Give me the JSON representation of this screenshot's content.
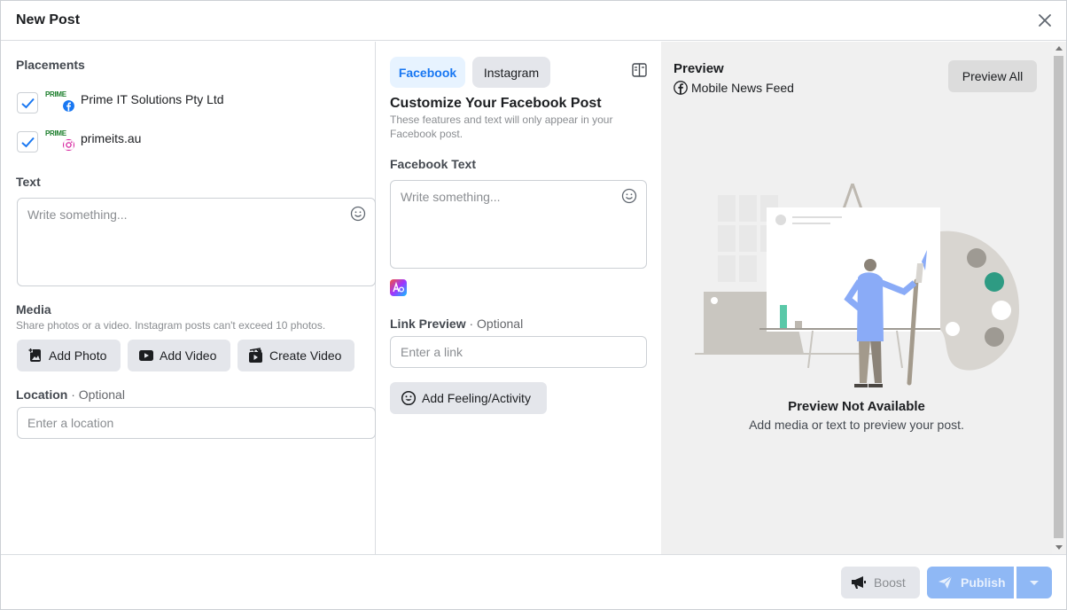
{
  "dialog": {
    "title": "New Post"
  },
  "placements": {
    "title": "Placements",
    "items": [
      {
        "name": "Prime IT Solutions Pty Ltd",
        "network": "facebook",
        "checked": true,
        "logo_text": "PRIME"
      },
      {
        "name": "primeits.au",
        "network": "instagram",
        "checked": true,
        "logo_text": "PRIME"
      }
    ]
  },
  "text_section": {
    "title": "Text",
    "placeholder": "Write something..."
  },
  "media": {
    "title": "Media",
    "hint": "Share photos or a video. Instagram posts can't exceed 10 photos.",
    "buttons": [
      "Add Photo",
      "Add Video",
      "Create Video"
    ]
  },
  "location": {
    "title": "Location",
    "optional": "· Optional",
    "placeholder": "Enter a location"
  },
  "tabs": {
    "facebook": "Facebook",
    "instagram": "Instagram"
  },
  "customize": {
    "title": "Customize Your Facebook Post",
    "hint": "These features and text will only appear in your Facebook post.",
    "fb_text_title": "Facebook Text",
    "fb_text_placeholder": "Write something...",
    "link_title": "Link Preview",
    "link_optional": "· Optional",
    "link_placeholder": "Enter a link",
    "feeling_label": "Add Feeling/Activity"
  },
  "preview": {
    "title": "Preview",
    "feed": "Mobile News Feed",
    "preview_all": "Preview All",
    "unavailable_title": "Preview Not Available",
    "unavailable_text": "Add media or text to preview your post."
  },
  "footer": {
    "boost": "Boost",
    "publish": "Publish"
  },
  "colors": {
    "accent": "#1877f2",
    "publish_disabled": "#8fb8f5",
    "preview_bg": "#f0f0f0"
  }
}
